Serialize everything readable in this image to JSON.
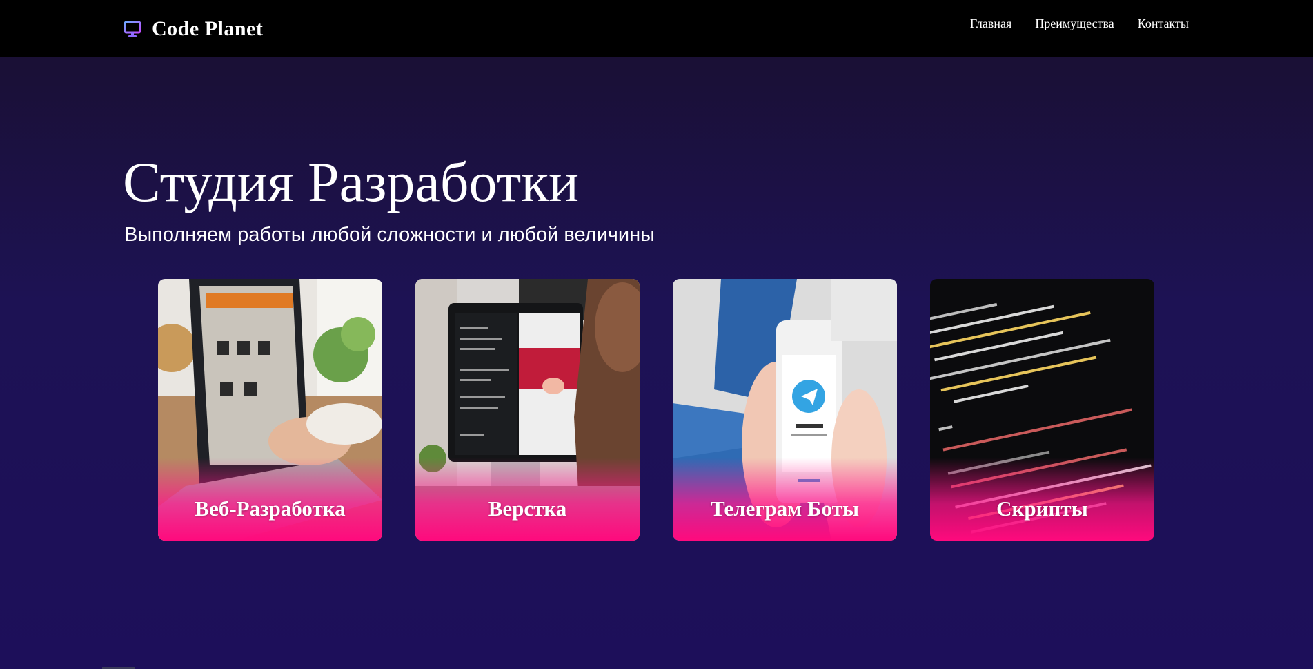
{
  "header": {
    "brand": "Code Planet",
    "brand_icon": "monitor-icon",
    "nav": [
      {
        "label": "Главная"
      },
      {
        "label": "Преимущества"
      },
      {
        "label": "Контакты"
      }
    ]
  },
  "hero": {
    "title": "Студия Разработки",
    "subtitle": "Выполняем работы любой сложности и любой величины"
  },
  "cards": [
    {
      "label": "Веб-Разработка",
      "image": "laptop-photo"
    },
    {
      "label": "Верстка",
      "image": "imac-code-photo"
    },
    {
      "label": "Телеграм Боты",
      "image": "telegram-phone-photo"
    },
    {
      "label": "Скрипты",
      "image": "code-screen-photo"
    }
  ],
  "colors": {
    "background": "#1d1254",
    "navbar": "#000000",
    "accent_pink": "#ff0a7d",
    "text": "#ffffff"
  }
}
